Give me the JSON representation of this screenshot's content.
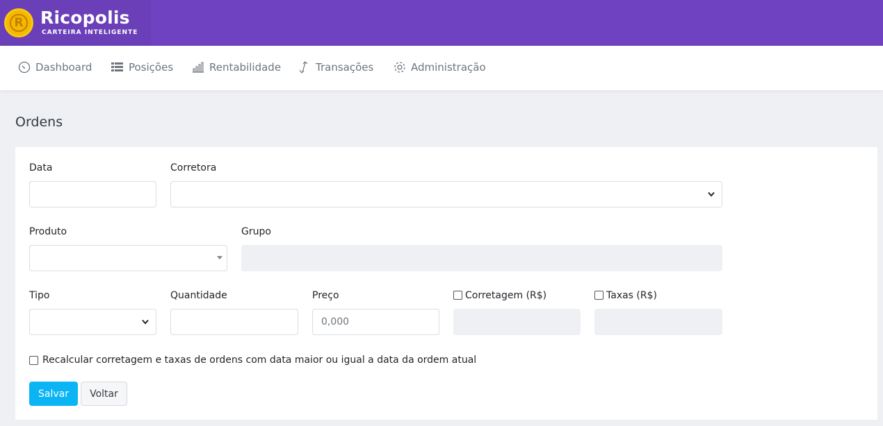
{
  "brand": {
    "name": "Ricopolis",
    "tagline": "CARTEIRA INTELIGENTE",
    "logo_letter": "R"
  },
  "nav": [
    {
      "label": "Dashboard",
      "icon": "speedometer-icon"
    },
    {
      "label": "Posições",
      "icon": "list-icon"
    },
    {
      "label": "Rentabilidade",
      "icon": "bar-chart-icon"
    },
    {
      "label": "Transações",
      "icon": "arrows-updown-icon"
    },
    {
      "label": "Administração",
      "icon": "gear-icon"
    }
  ],
  "page": {
    "title": "Ordens"
  },
  "form": {
    "data_label": "Data",
    "corretora_label": "Corretora",
    "produto_label": "Produto",
    "grupo_label": "Grupo",
    "tipo_label": "Tipo",
    "quantidade_label": "Quantidade",
    "preco_label": "Preço",
    "preco_placeholder": "0,000",
    "corretagem_label": "Corretagem (R$)",
    "taxas_label": "Taxas (R$)",
    "recalcular_label": "Recalcular corretagem e taxas de ordens com data maior ou igual a data da ordem atual"
  },
  "buttons": {
    "save": "Salvar",
    "back": "Voltar"
  },
  "colors": {
    "topbar": "#6f42c1",
    "primary_button": "#0bb5f4",
    "logo": "#f5b800"
  }
}
